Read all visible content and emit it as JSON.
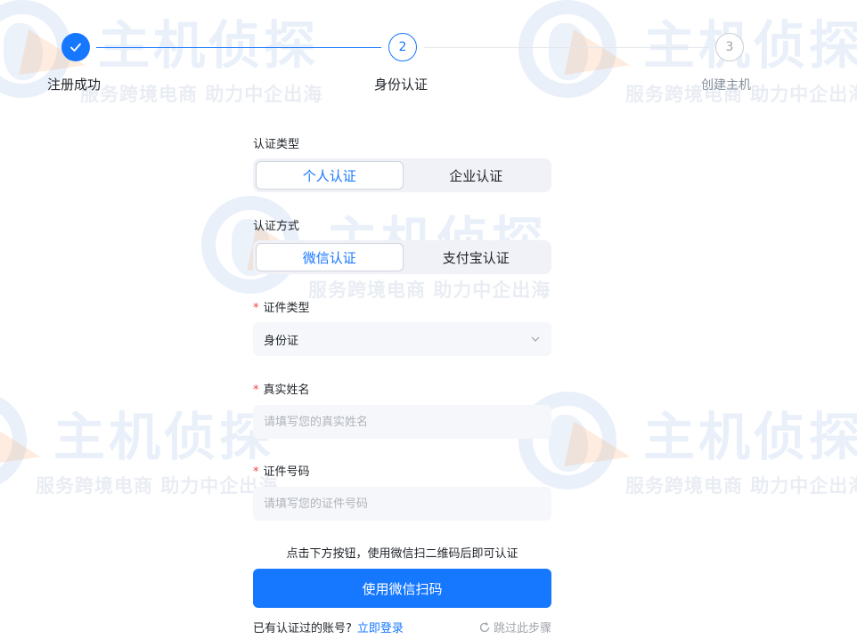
{
  "steps": [
    {
      "index": "1",
      "label": "注册成功",
      "state": "done"
    },
    {
      "index": "2",
      "label": "身份认证",
      "state": "active"
    },
    {
      "index": "3",
      "label": "创建主机",
      "state": "todo"
    }
  ],
  "watermark": {
    "title": "主机侦探",
    "subtitle": "服务跨境电商 助力中企出海"
  },
  "form": {
    "auth_type": {
      "label": "认证类型",
      "options": [
        "个人认证",
        "企业认证"
      ],
      "selected_index": 0
    },
    "auth_method": {
      "label": "认证方式",
      "options": [
        "微信认证",
        "支付宝认证"
      ],
      "selected_index": 0
    },
    "id_type": {
      "required_mark": "*",
      "label": "证件类型",
      "value": "身份证"
    },
    "real_name": {
      "required_mark": "*",
      "label": "真实姓名",
      "placeholder": "请填写您的真实姓名",
      "value": ""
    },
    "id_number": {
      "required_mark": "*",
      "label": "证件号码",
      "placeholder": "请填写您的证件号码",
      "value": ""
    },
    "hint": "点击下方按钮，使用微信扫二维码后即可认证",
    "scan_button": "使用微信扫码",
    "have_account": "已有认证过的账号?",
    "login_link": "立即登录",
    "skip_link": "跳过此步骤"
  },
  "colors": {
    "primary": "#1677ff",
    "required": "#f53f3f",
    "input_bg": "#f5f7fa",
    "segment_bg": "#f0f2f7"
  }
}
